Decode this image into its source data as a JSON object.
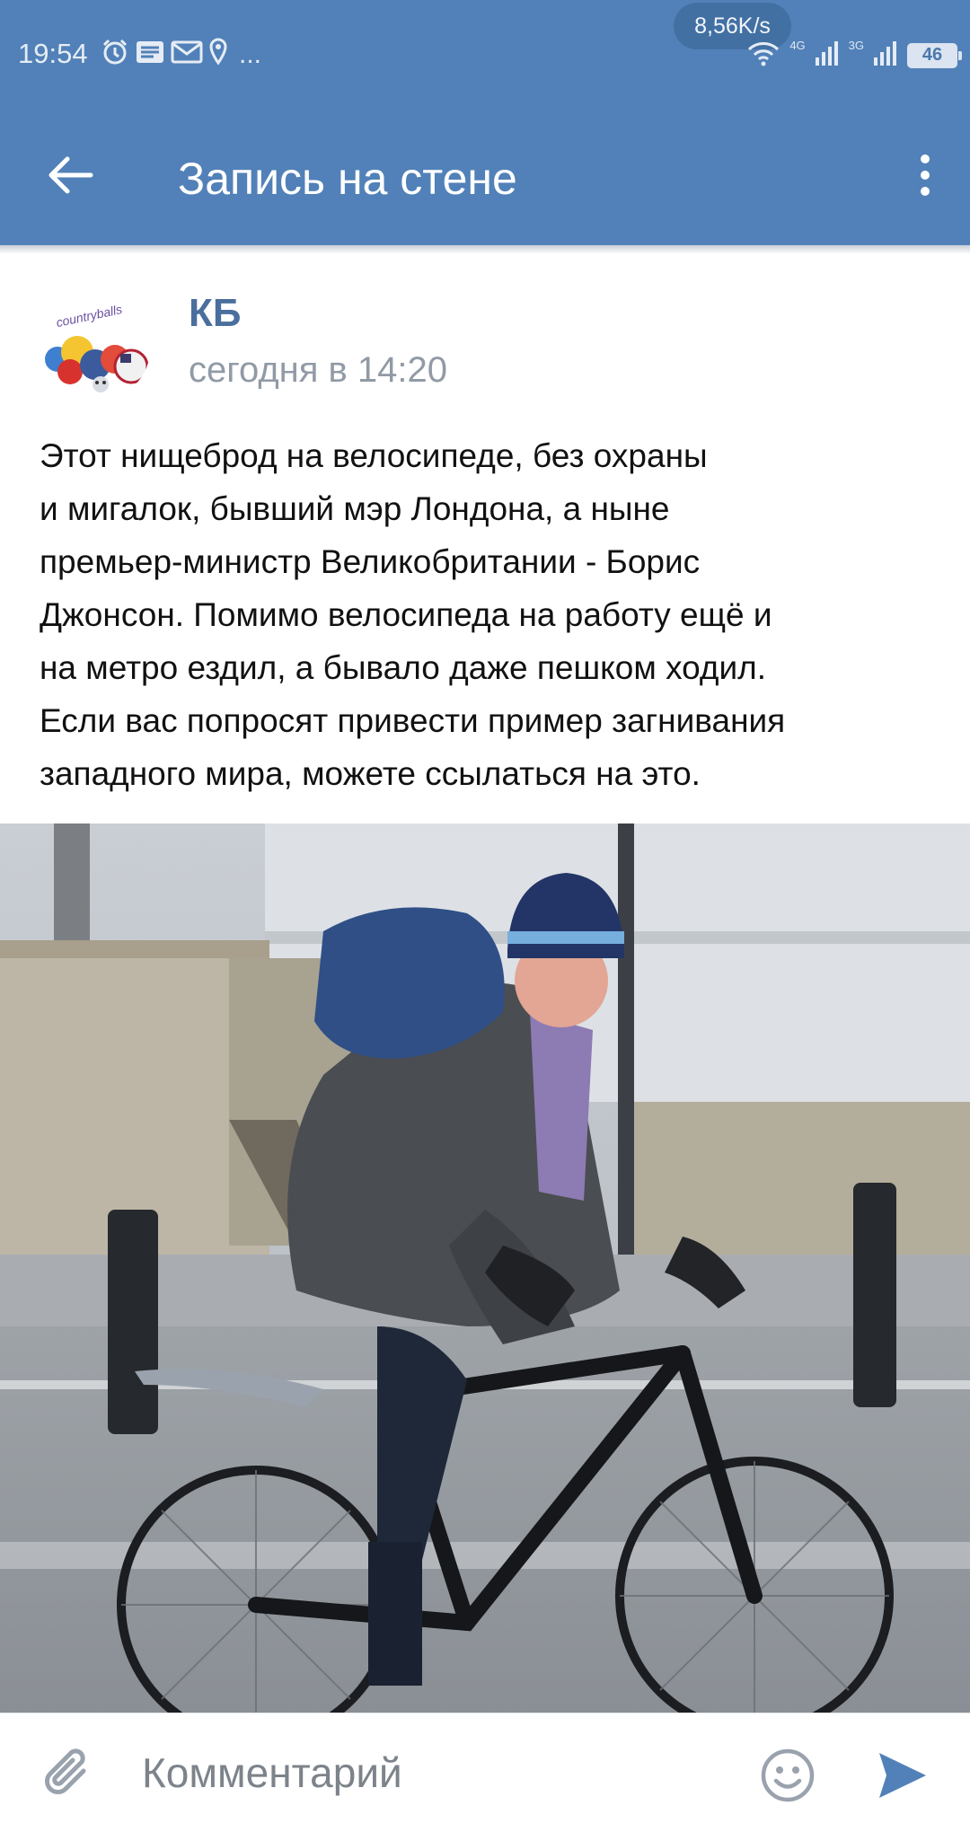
{
  "status_bar": {
    "time": "19:54",
    "more": "...",
    "net_speed": "8,56K/s",
    "network_1": "4G",
    "network_2": "3G",
    "battery": "46",
    "icons": [
      "alarm-icon",
      "notes-icon",
      "mail-icon",
      "location-icon",
      "wifi-icon",
      "signal-icon",
      "battery-icon"
    ]
  },
  "app_bar": {
    "title": "Запись на стене",
    "back_icon": "arrow-left-icon",
    "menu_icon": "more-vertical-icon",
    "background": "#5181b8"
  },
  "post": {
    "author": "КБ",
    "time": "сегодня в 14:20",
    "avatar_text": "countryballs",
    "text_lines": [
      "Этот нищеброд на велосипеде, без охраны",
      "и мигалок, бывший мэр Лондона, а ныне",
      "премьер-министр Великобритании - Борис",
      "Джонсон. Помимо велосипеда на работу ещё и",
      "на метро ездил, а бывало даже пешком ходил.",
      "Если вас попросят привести пример загнивания",
      "западного мира, можете ссылаться на это."
    ]
  },
  "composer": {
    "placeholder": "Комментарий",
    "attach_icon": "paperclip-icon",
    "emoji_icon": "smile-icon",
    "send_icon": "send-icon",
    "accent": "#5181b8"
  }
}
